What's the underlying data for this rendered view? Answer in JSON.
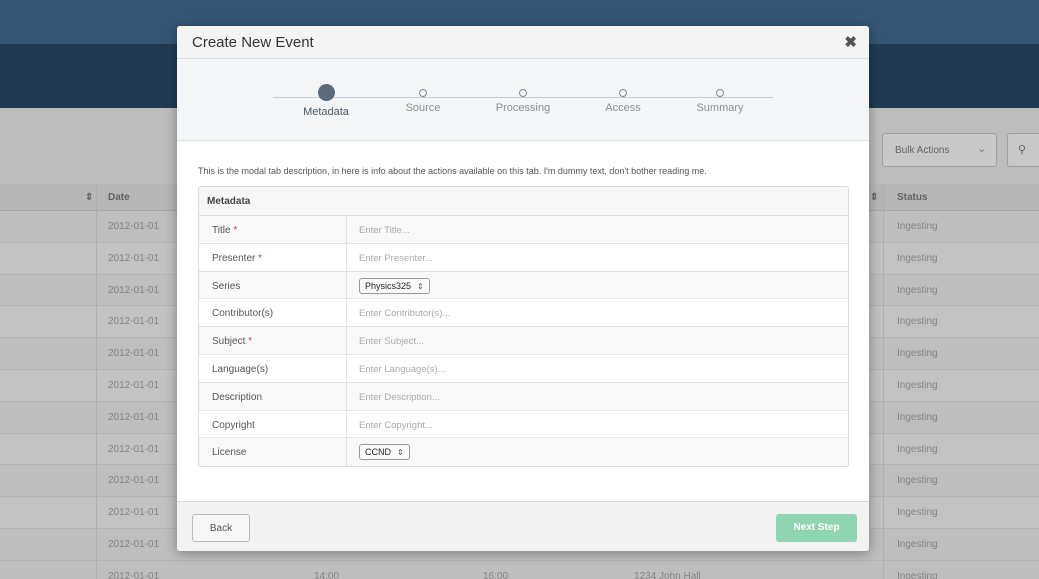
{
  "background": {
    "toolbar": {
      "bulk_actions_label": "Bulk Actions"
    },
    "table": {
      "headers": {
        "date": "Date",
        "status": "Status"
      },
      "rows": [
        {
          "date": "2012-01-01",
          "status": "Ingesting"
        },
        {
          "date": "2012-01-01",
          "status": "Ingesting"
        },
        {
          "date": "2012-01-01",
          "status": "Ingesting"
        },
        {
          "date": "2012-01-01",
          "status": "Ingesting"
        },
        {
          "date": "2012-01-01",
          "status": "Ingesting"
        },
        {
          "date": "2012-01-01",
          "status": "Ingesting"
        },
        {
          "date": "2012-01-01",
          "status": "Ingesting"
        },
        {
          "date": "2012-01-01",
          "status": "Ingesting"
        },
        {
          "date": "2012-01-01",
          "status": "Ingesting"
        },
        {
          "date": "2012-01-01",
          "status": "Ingesting"
        },
        {
          "date": "2012-01-01",
          "status": "Ingesting"
        }
      ],
      "last_row": {
        "date": "2012-01-01",
        "start": "14:00",
        "end": "16:00",
        "location": "1234 John Hall",
        "status": "Ingesting"
      }
    }
  },
  "modal": {
    "title": "Create New Event",
    "close_glyph": "✖",
    "steps": [
      {
        "label": "Metadata",
        "active": true
      },
      {
        "label": "Source",
        "active": false
      },
      {
        "label": "Processing",
        "active": false
      },
      {
        "label": "Access",
        "active": false
      },
      {
        "label": "Summary",
        "active": false
      }
    ],
    "description": "This is the modal tab description, in here is info about the actions available on this tab. I'm dummy text, don't bother reading me.",
    "panel_title": "Metadata",
    "fields": {
      "title": {
        "label": "Title",
        "required": "*",
        "placeholder": "Enter Title..."
      },
      "presenter": {
        "label": "Presenter",
        "required": "*",
        "placeholder": "Enter Presenter..."
      },
      "series": {
        "label": "Series",
        "value": "Physics325"
      },
      "contributors": {
        "label": "Contributor(s)",
        "placeholder": "Enter Contributor(s)..."
      },
      "subject": {
        "label": "Subject",
        "required": "*",
        "placeholder": "Enter Subject..."
      },
      "languages": {
        "label": "Language(s)",
        "placeholder": "Enter Language(s)..."
      },
      "description": {
        "label": "Description",
        "placeholder": "Enter Description..."
      },
      "copyright": {
        "label": "Copyright",
        "placeholder": "Enter Copyright..."
      },
      "license": {
        "label": "License",
        "value": "CCND"
      }
    },
    "footer": {
      "back_label": "Back",
      "next_label": "Next Step"
    },
    "colors": {
      "next_button": "#8fd5b1",
      "active_step": "#5b6b7c",
      "required": "#d9363e"
    }
  }
}
